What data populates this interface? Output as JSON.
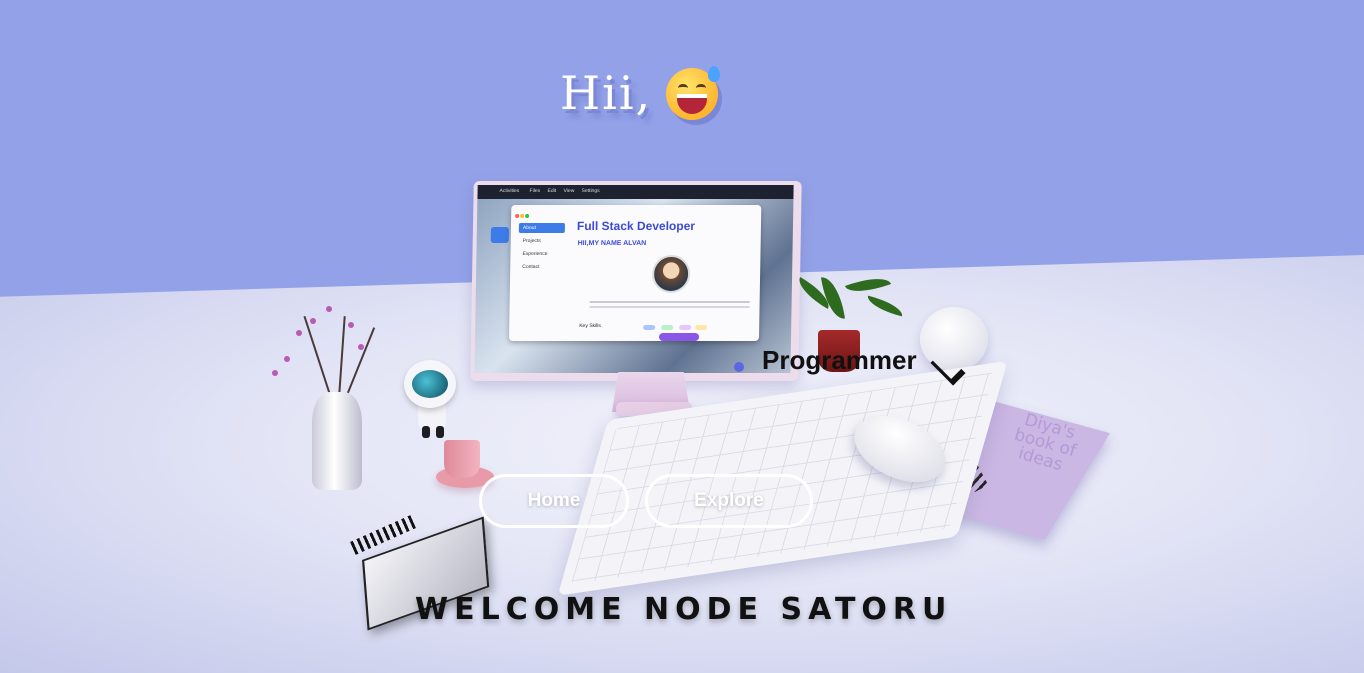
{
  "hero": {
    "greeting": "Hii,",
    "emoji_icon": "grinning-sweat-emoji"
  },
  "monitor_screen": {
    "taskbar_items": [
      "Activities",
      "Files",
      "Edit",
      "View",
      "Settings"
    ],
    "sidebar_items": [
      "About",
      "Projects",
      "Experience",
      "Contact"
    ],
    "title": "Full Stack Developer",
    "subtitle": "HII,MY NAME ALVAN",
    "skills_label": "Key Skills"
  },
  "role": {
    "label": "Programmer"
  },
  "book": {
    "cover_text": "Diya's book of ideas"
  },
  "nav": {
    "home_label": "Home",
    "explore_label": "Explore"
  },
  "footer": {
    "welcome_text": "WELCOME NODE SATORU"
  },
  "colors": {
    "wall": "#93a2e8",
    "accent": "#5b66e0",
    "button_border": "#ffffff"
  }
}
